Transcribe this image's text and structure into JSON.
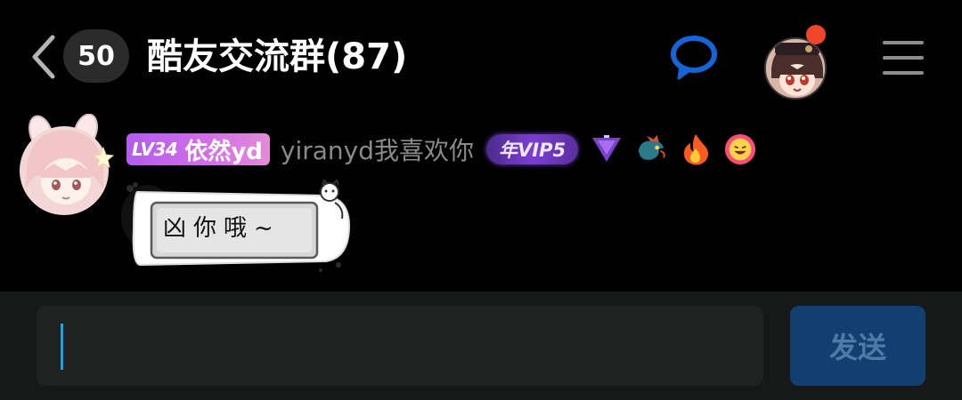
{
  "header": {
    "back_icon": "chevron-left-icon",
    "unread_count": "50",
    "title": "酷友交流群(87)",
    "chat_icon": "chat-bubble-icon",
    "menu_icon": "hamburger-menu-icon"
  },
  "message": {
    "level": "LV34",
    "nickname": "依然yd",
    "username": "yiranyd我喜欢你",
    "vip": "年VIP5",
    "badges": [
      "purple-triangle-icon",
      "dragon-icon",
      "fire-icon",
      "grinning-face-icon"
    ],
    "text": "凶你哦~"
  },
  "input": {
    "value": "",
    "send_label": "发送"
  },
  "colors": {
    "background": "#000000",
    "accent_blue": "#1565d8",
    "send_button": "#123f70",
    "level_badge": "#c064ee",
    "red_dot": "#f0452b"
  }
}
